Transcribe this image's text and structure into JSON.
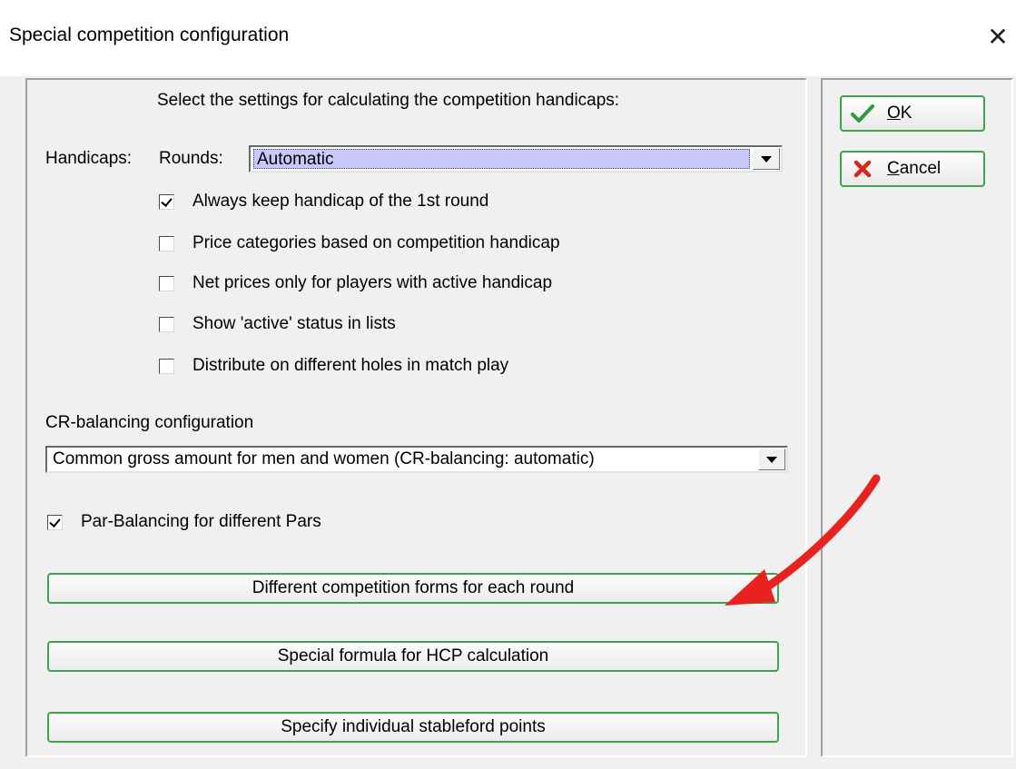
{
  "window": {
    "title": "Special competition configuration",
    "close_glyph": "✕"
  },
  "header": {
    "instruction": "Select the settings for calculating the competition handicaps:"
  },
  "handicaps": {
    "label": "Handicaps:",
    "rounds_label": "Rounds:",
    "rounds_value": "Automatic"
  },
  "checkboxes": [
    {
      "label": "Always keep handicap of the 1st round",
      "checked": true
    },
    {
      "label": "Price categories based on competition handicap",
      "checked": false
    },
    {
      "label": "Net prices only for players with active handicap",
      "checked": false
    },
    {
      "label": "Show 'active' status in lists",
      "checked": false
    },
    {
      "label": "Distribute on different holes in match play",
      "checked": false
    }
  ],
  "cr_balancing": {
    "label": "CR-balancing configuration",
    "value": "Common gross amount for men and women (CR-balancing: automatic)"
  },
  "par_balancing": {
    "label": "Par-Balancing for different Pars",
    "checked": true
  },
  "buttons": {
    "different_forms": "Different competition forms for each round",
    "special_formula": "Special formula for HCP calculation",
    "stableford": "Specify individual stableford points"
  },
  "side_buttons": {
    "ok_mnemonic": "O",
    "ok_rest": "K",
    "cancel_mnemonic": "C",
    "cancel_rest": "ancel"
  },
  "colors": {
    "accent_green": "#3fa34d",
    "arrow_red": "#e8221f",
    "selection": "#c9c8fb"
  },
  "icons": {
    "ok": "check-icon",
    "cancel": "x-icon",
    "annotation": "red-arrow-icon"
  }
}
